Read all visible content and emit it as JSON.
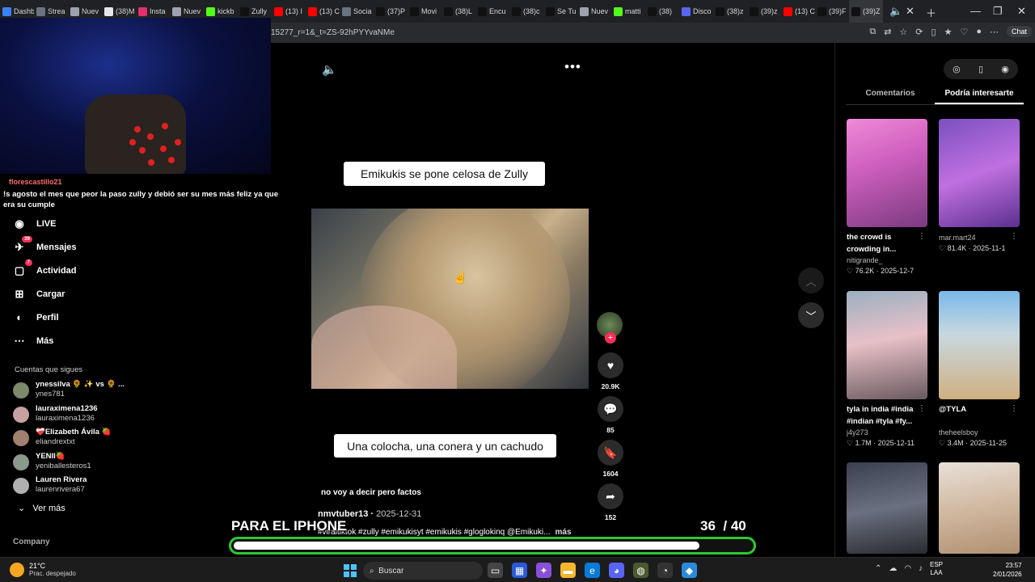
{
  "browser": {
    "tabs": [
      {
        "label": "Dashb",
        "color": "#3b82f6",
        "active": false
      },
      {
        "label": "Strea",
        "color": "#6b7280",
        "active": false
      },
      {
        "label": "Nuev",
        "color": "#9ca3af",
        "active": false
      },
      {
        "label": "(38)M",
        "color": "#e5e7eb",
        "active": false
      },
      {
        "label": "Insta",
        "color": "#e1306c",
        "active": false
      },
      {
        "label": "Nuev",
        "color": "#9ca3af",
        "active": false
      },
      {
        "label": "kickb",
        "color": "#53fc18",
        "active": false
      },
      {
        "label": "Zully",
        "color": "#111111",
        "active": false
      },
      {
        "label": "(13) I",
        "color": "#ff0000",
        "active": false
      },
      {
        "label": "(13) C",
        "color": "#ff0000",
        "active": false
      },
      {
        "label": "Socia",
        "color": "#6b7280",
        "active": false
      },
      {
        "label": "(37)P",
        "color": "#111111",
        "active": false
      },
      {
        "label": "Movi",
        "color": "#111111",
        "active": false
      },
      {
        "label": "(38)L",
        "color": "#111111",
        "active": false
      },
      {
        "label": "Encu",
        "color": "#111111",
        "active": false
      },
      {
        "label": "(38)c",
        "color": "#111111",
        "active": false
      },
      {
        "label": "Se Tu",
        "color": "#111111",
        "active": false
      },
      {
        "label": "Nuev",
        "color": "#9ca3af",
        "active": false
      },
      {
        "label": "matti",
        "color": "#53fc18",
        "active": false
      },
      {
        "label": "(38)",
        "color": "#111111",
        "active": false
      },
      {
        "label": "Disco",
        "color": "#5865f2",
        "active": false
      },
      {
        "label": "(38)z",
        "color": "#111111",
        "active": false
      },
      {
        "label": "(39)z",
        "color": "#111111",
        "active": false
      },
      {
        "label": "(13) C",
        "color": "#ff0000",
        "active": false
      },
      {
        "label": "(39)F",
        "color": "#111111",
        "active": false
      },
      {
        "label": "(39)Z",
        "color": "#111111",
        "active": true
      }
    ],
    "url": "15277_r=1&_t=ZS-92hPYYvaNMe",
    "chat_button": "Chat"
  },
  "stream_chat": {
    "username": "florescastillo21",
    "message": "!s agosto el mes que peor la paso zully y debió ser su mes más feliz ya que era su cumple"
  },
  "sidebar": {
    "items": [
      {
        "label": "LIVE",
        "icon": "live-icon",
        "badge": ""
      },
      {
        "label": "Mensajes",
        "icon": "messages-icon",
        "badge": "29"
      },
      {
        "label": "Actividad",
        "icon": "activity-icon",
        "badge": "7"
      },
      {
        "label": "Cargar",
        "icon": "upload-icon",
        "badge": ""
      },
      {
        "label": "Perfil",
        "icon": "profile-icon",
        "badge": ""
      },
      {
        "label": "Más",
        "icon": "more-icon",
        "badge": ""
      }
    ],
    "following_title": "Cuentas que sigues",
    "following": [
      {
        "name": "ynessilva 🌻 ✨ vs 🌻 ...",
        "handle": "ynes781",
        "color": "#7a8a6a"
      },
      {
        "name": "lauraximena1236",
        "handle": "lauraximena1236",
        "color": "#c8a0a0"
      },
      {
        "name": "❤️‍🩹Elizabeth Ávila 🍓",
        "handle": "eliandrextxt",
        "color": "#a08070"
      },
      {
        "name": "YENII🍓",
        "handle": "yeniballesteros1",
        "color": "#8a9a8a"
      },
      {
        "name": "Lauren Rivera",
        "handle": "laurenrivera67",
        "color": "#b0b0b0"
      }
    ],
    "see_more": "Ver más",
    "company": "Company"
  },
  "video": {
    "caption_top": "Emikukis se pone celosa de Zully",
    "caption_bottom": "Una colocha, una conera y un cachudo",
    "description": "no voy a decir pero factos",
    "author": "nmvtuber13",
    "date": "2025-12-31",
    "hashtags": "#viraltiktok #zully #emikukisyt #emikukis #gloglokinq @Emikuki...",
    "more": "más"
  },
  "actions": {
    "likes": "20.9K",
    "comments": "85",
    "saves": "1604",
    "shares": "152"
  },
  "goal": {
    "label": "PARA EL IPHONE",
    "current": "36",
    "total": "/ 40",
    "progress": 0.9
  },
  "right_panel": {
    "tabs": [
      "Comentarios",
      "Podría interesarte"
    ],
    "active_tab": 1,
    "cards": [
      {
        "title": "the crowd is crowding in...",
        "user": "nitigrande_",
        "likes": "76.2K",
        "date": "2025-12-7",
        "thumb": "linear-gradient(160deg,#f08ad8 0%,#d060c0 40%,#7a3a80 100%)"
      },
      {
        "title": "",
        "user": "mar.mart24",
        "likes": "81.4K",
        "date": "2025-11-1",
        "thumb": "linear-gradient(160deg,#7a50c0 0%,#c070e0 50%,#5a3090 100%)"
      },
      {
        "title": "tyla in india #india #indian #tyla #fy...",
        "user": "j4y273",
        "likes": "1.7M",
        "date": "2025-12-11",
        "thumb": "linear-gradient(170deg,#9ab0c0 0%,#e8c0c8 45%,#6a5a60 100%)"
      },
      {
        "title": "@TYLA",
        "user": "theheelsboy",
        "likes": "3.4M",
        "date": "2025-11-25",
        "thumb": "linear-gradient(180deg,#7ab8e8 0%,#c8d8e0 40%,#d0b080 100%)"
      },
      {
        "title": "",
        "user": "",
        "likes": "",
        "date": "",
        "thumb": "linear-gradient(170deg,#3a4050 0%,#6a7080 50%,#2a2a30 100%)"
      },
      {
        "title": "",
        "user": "",
        "likes": "",
        "date": "",
        "thumb": "linear-gradient(170deg,#e8e0d8 0%,#d0b8a0 50%,#b09070 100%)"
      }
    ]
  },
  "taskbar": {
    "temperature": "21°C",
    "weather": "Prac. despejado",
    "search": "Buscar",
    "lang_1": "ESP",
    "lang_2": "LAA",
    "time": "23:57",
    "date": "2/01/2026"
  }
}
